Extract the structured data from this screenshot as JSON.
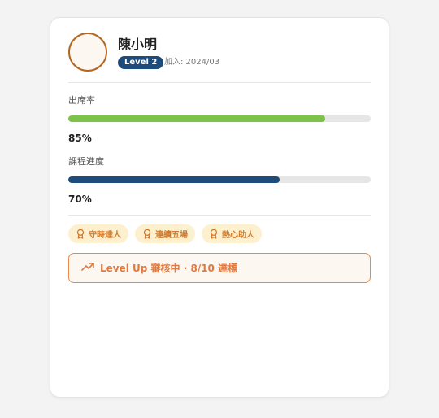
{
  "profile": {
    "name": "陳小明",
    "level": "Level 2",
    "joined": "加入: 2024/03"
  },
  "metrics": [
    {
      "label": "出席率",
      "value_text": "85%",
      "progress": 0.85,
      "color": "#7dc24b"
    },
    {
      "label": "課程進度",
      "value_text": "70%",
      "progress": 0.7,
      "color": "#1c4b7c"
    }
  ],
  "badges": [
    {
      "label": "守時達人",
      "icon": "award-icon"
    },
    {
      "label": "連續五場",
      "icon": "award-icon"
    },
    {
      "label": "熱心助人",
      "icon": "award-icon"
    }
  ],
  "levelup": {
    "icon": "trending-up-icon",
    "text": "Level Up 審核中 · 8/10 達標"
  },
  "colors": {
    "accent": "#e07a3f",
    "badge_bg": "#fdf0cf",
    "level_badge": "#1c4b7c",
    "avatar_border": "#b5651d"
  }
}
